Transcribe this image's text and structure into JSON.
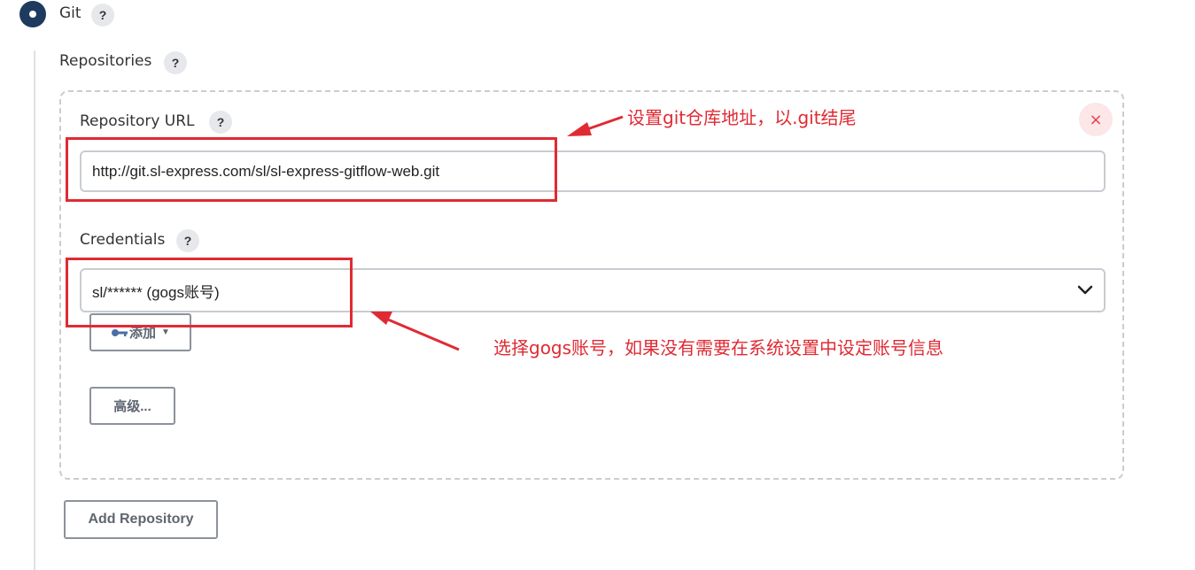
{
  "scm": {
    "git_label": "Git",
    "help_glyph": "?"
  },
  "repositories": {
    "label": "Repositories",
    "repository_url": {
      "label": "Repository URL",
      "value": "http://git.sl-express.com/sl/sl-express-gitflow-web.git"
    },
    "credentials": {
      "label": "Credentials",
      "selected": "sl/****** (gogs账号)",
      "add_button": "添加"
    },
    "advanced_button": "高级...",
    "close_glyph": "×",
    "add_repository_button": "Add Repository"
  },
  "annotations": {
    "url_note": "设置git仓库地址，以.git结尾",
    "credentials_note": "选择gogs账号，如果没有需要在系统设置中设定账号信息"
  },
  "colors": {
    "annotation_red": "#e02a33",
    "radio_fill": "#1f3a5f",
    "close_red": "#e5414f"
  }
}
